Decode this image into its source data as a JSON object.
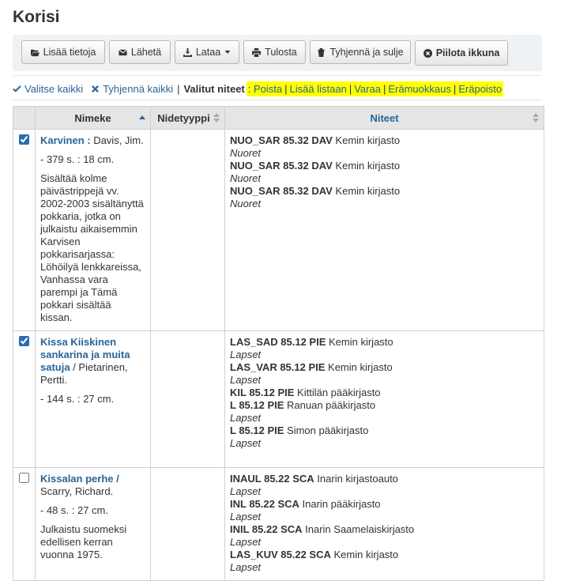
{
  "page": {
    "title": "Korisi"
  },
  "toolbar": {
    "add_info": "Lisää tietoja",
    "send": "Lähetä",
    "download": "Lataa",
    "print": "Tulosta",
    "empty_close": "Tyhjennä ja sulje",
    "hide_window": "Piilota ikkuna"
  },
  "selection": {
    "select_all": "Valitse kaikki",
    "clear_all": "Tyhjennä kaikki",
    "selected_label": "Valitut niteet",
    "colon": " :",
    "actions": [
      "Poista",
      "Lisää listaan",
      "Varaa",
      "Erämuokkaus",
      "Eräpoisto"
    ]
  },
  "table": {
    "headers": {
      "title": "Nimeke",
      "itemtype": "Nidetyyppi",
      "items": "Niteet"
    },
    "rows": [
      {
        "checked": true,
        "title": "Karvinen :",
        "author": " Davis, Jim.",
        "desc": "- 379 s. : 18 cm.",
        "note": "Sisältää kolme päivästrippejä vv. 2002-2003 sisältänyttä pokkaria, jotka on julkaistu aikaisemmin Karvisen pokkarisarjassa: Löhöilyä lenkkareissa, Vanhassa vara parempi ja Tämä pokkari sisältää kissan.",
        "itemtype": "",
        "items": [
          {
            "callnumber": "NUO_SAR 85.32 DAV",
            "library": " Kemin kirjasto",
            "type": "Nuoret"
          },
          {
            "callnumber": "NUO_SAR 85.32 DAV",
            "library": " Kemin kirjasto",
            "type": "Nuoret"
          },
          {
            "callnumber": "NUO_SAR 85.32 DAV",
            "library": " Kemin kirjasto",
            "type": "Nuoret"
          }
        ]
      },
      {
        "checked": true,
        "title": "Kissa Kiiskinen sankarina ja muita satuja",
        "author": " / Pietarinen, Pertti.",
        "desc": "- 144 s. : 27 cm.",
        "note": "",
        "itemtype": "",
        "items": [
          {
            "callnumber": "LAS_SAD 85.12 PIE",
            "library": " Kemin kirjasto",
            "type": "Lapset"
          },
          {
            "callnumber": "LAS_VAR 85.12 PIE",
            "library": " Kemin kirjasto",
            "type": "Lapset"
          },
          {
            "callnumber": "KIL 85.12 PIE",
            "library": " Kittilän pääkirjasto",
            "type": "Lapset"
          },
          {
            "callnumber": "L 85.12 PIE",
            "library": " Ranuan pääkirjasto",
            "type": "Lapset"
          },
          {
            "callnumber": "L 85.12 PIE",
            "library": " Simon pääkirjasto",
            "type": "Lapset"
          }
        ]
      },
      {
        "checked": false,
        "title": "Kissalan perhe /",
        "author": " Scarry, Richard.",
        "desc": "- 48 s. : 27 cm.",
        "note": "Julkaistu suomeksi edellisen kerran vuonna 1975.",
        "itemtype": "",
        "items": [
          {
            "callnumber": "INAUL 85.22 SCA",
            "library": " Inarin kirjastoauto",
            "type": "Lapset"
          },
          {
            "callnumber": "INL 85.22 SCA",
            "library": " Inarin pääkirjasto",
            "type": "Lapset"
          },
          {
            "callnumber": "INIL 85.22 SCA",
            "library": " Inarin Saamelaiskirjasto",
            "type": "Lapset"
          },
          {
            "callnumber": "LAS_KUV 85.22 SCA",
            "library": " Kemin kirjasto",
            "type": "Lapset"
          }
        ]
      }
    ]
  },
  "colors": {
    "link": "#2a6496",
    "highlight": "#ffff00",
    "toolbar_bg": "#eef2f5",
    "header_bg": "#e5e5e5"
  }
}
